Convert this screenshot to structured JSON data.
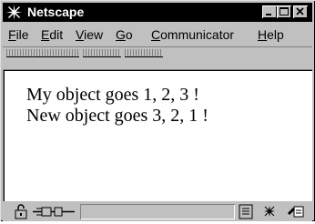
{
  "window": {
    "title": "Netscape",
    "title_icon": "netscape-n-icon"
  },
  "titlebar_buttons": {
    "minimize_icon": "minimize-icon",
    "maximize_icon": "maximize-icon",
    "close_icon": "close-icon"
  },
  "menu": {
    "items": [
      {
        "label": "File",
        "mnemonic": "F",
        "rest": "ile"
      },
      {
        "label": "Edit",
        "mnemonic": "E",
        "rest": "dit"
      },
      {
        "label": "View",
        "mnemonic": "V",
        "rest": "iew"
      },
      {
        "label": "Go",
        "mnemonic": "G",
        "rest": "o"
      },
      {
        "label": "Communicator",
        "mnemonic": "C",
        "rest": "ommunicator"
      },
      {
        "label": "Help",
        "mnemonic": "H",
        "rest": "elp"
      }
    ]
  },
  "content": {
    "lines": [
      "My object goes 1, 2, 3 !",
      "New object goes 3, 2, 1 !"
    ]
  },
  "statusbar": {
    "icons": [
      "security-lock-icon",
      "connection-plug-icon",
      "grip-icon",
      "component-bar-icon",
      "composer-icon"
    ]
  },
  "colors": {
    "titlebar": "#000000",
    "chrome": "#c0c0c0",
    "page_background": "#ffffff"
  }
}
